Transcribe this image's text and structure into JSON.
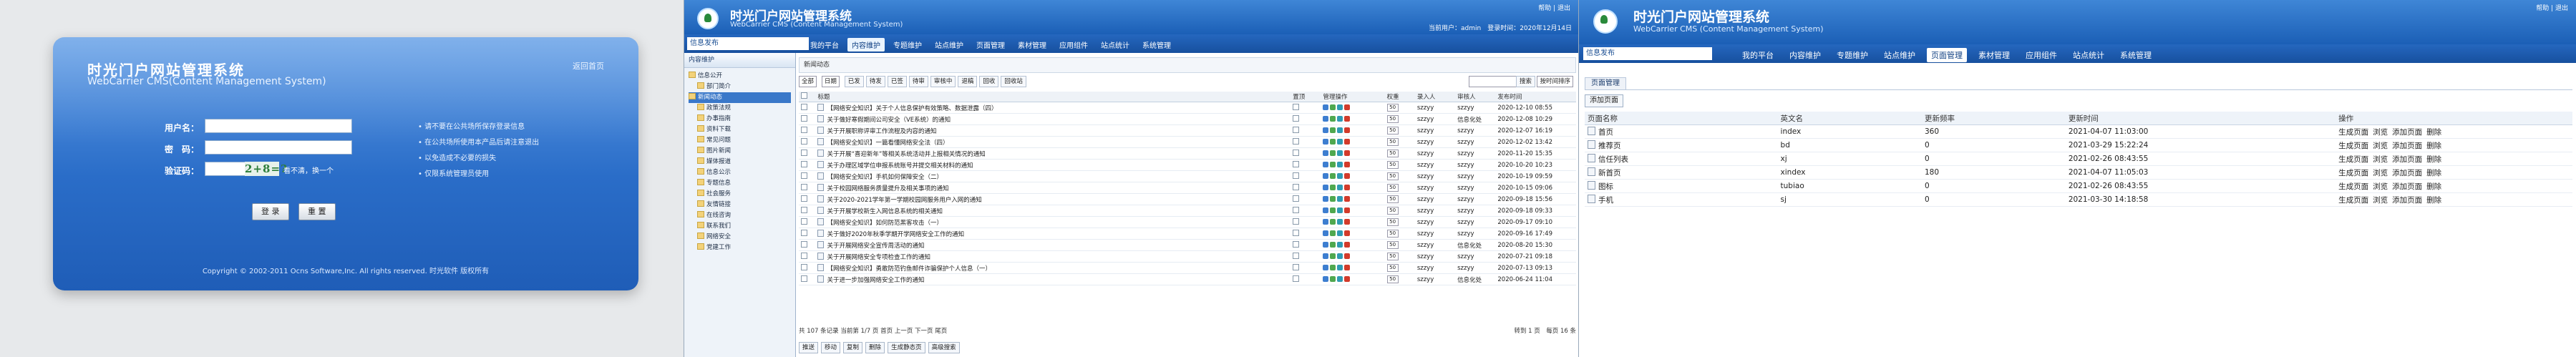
{
  "login": {
    "title": "时光门户网站管理系统",
    "subtitle": "WebCarrier CMS(Content Management System)",
    "home_link": "返回首页",
    "username_label": "用户名：",
    "password_label": "密　码：",
    "captcha_label": "验证码：",
    "captcha_code": "2+8=?",
    "captcha_refresh": "看不清，换一个",
    "tips": [
      "请不要在公共场所保存登录信息",
      "在公共场所使用本产品后请注意退出",
      "以免造成不必要的损失",
      "仅限系统管理员使用"
    ],
    "login_button": "登 录",
    "reset_button": "重 置",
    "copyright": "Copyright © 2002-2011 Ocns Software,Inc. All rights reserved. 时光软件 版权所有"
  },
  "cms": {
    "title": "时光门户网站管理系统",
    "subtitle": "WebCarrier CMS (Content Management System)",
    "top_right": "帮助 | 退出",
    "user_info": "当前用户：admin　登录时间：2020年12月14日　退出系统",
    "current_section": "信息发布",
    "nav": [
      "我的平台",
      "内容维护",
      "专题维护",
      "站点维护",
      "页面管理",
      "素材管理",
      "应用组件",
      "站点统计",
      "系统管理"
    ],
    "sidebar_head": "内容维护",
    "tree": [
      "信息公开",
      "部门简介",
      "新闻动态",
      "政策法规",
      "办事指南",
      "资料下载",
      "常见问题",
      "图片新闻",
      "媒体报道",
      "信息公示",
      "专题信息",
      "社会服务",
      "友情链接",
      "在线咨询",
      "联系我们",
      "网络安全",
      "党建工作"
    ],
    "tree_selected": 2,
    "crumb": "新闻动态",
    "filter_all": "全部",
    "filter_all_day": "日期",
    "toolbar": [
      "已发",
      "待发",
      "已签",
      "待审",
      "审核中",
      "退稿",
      "回收",
      "回收站"
    ],
    "search_btn": "搜索",
    "sort_label": "按时间排序",
    "columns": [
      "",
      "标题",
      "置顶",
      "管理操作",
      "权重",
      "录入人",
      "审核人",
      "发布时间"
    ],
    "rows": [
      {
        "title": "【网络安全知识】关于个人信息保护有效策略、数据泄露（四）",
        "author": "szzyy",
        "reviewer": "szzyy",
        "date": "2020-12-10 08:55"
      },
      {
        "title": "关于做好寒假期间公司安全（VE系统）的通知",
        "author": "szzyy",
        "reviewer": "信息化处",
        "date": "2020-12-08 10:29"
      },
      {
        "title": "关于开展职称评审工作流程及内容的通知",
        "author": "szzyy",
        "reviewer": "szzyy",
        "date": "2020-12-07 16:19"
      },
      {
        "title": "【网络安全知识】一篇看懂网络安全法（四）",
        "author": "szzyy",
        "reviewer": "szzyy",
        "date": "2020-12-02 13:42"
      },
      {
        "title": "关于开展“喜迎新年”等相关系统活动并上报相关情况的通知",
        "author": "szzyy",
        "reviewer": "szzyy",
        "date": "2020-11-20 15:35"
      },
      {
        "title": "关于办理区域学位申报系统账号并提交相关材料的通知",
        "author": "szzyy",
        "reviewer": "szzyy",
        "date": "2020-10-20 10:23"
      },
      {
        "title": "【网络安全知识】手机如何保障安全（二）",
        "author": "szzyy",
        "reviewer": "szzyy",
        "date": "2020-10-19 09:59"
      },
      {
        "title": "关于校园网络服务质量提升及相关事项的通知",
        "author": "szzyy",
        "reviewer": "szzyy",
        "date": "2020-10-15 09:06"
      },
      {
        "title": "关于2020-2021学年第一学期校园网服务用户入网的通知",
        "author": "szzyy",
        "reviewer": "szzyy",
        "date": "2020-09-18 15:56"
      },
      {
        "title": "关于开展学校新生入网信息系统的相关通知",
        "author": "szzyy",
        "reviewer": "szzyy",
        "date": "2020-09-18 09:33"
      },
      {
        "title": "【网络安全知识】如何防范黑客攻击（一）",
        "author": "szzyy",
        "reviewer": "szzyy",
        "date": "2020-09-17 09:10"
      },
      {
        "title": "关于做好2020年秋季学期开学网络安全工作的通知",
        "author": "szzyy",
        "reviewer": "szzyy",
        "date": "2020-09-16 17:49"
      },
      {
        "title": "关于开展网络安全宣传周活动的通知",
        "author": "szzyy",
        "reviewer": "信息化处",
        "date": "2020-08-20 15:30"
      },
      {
        "title": "关于开展网络安全专项检查工作的通知",
        "author": "szzyy",
        "reviewer": "szzyy",
        "date": "2020-07-21 09:18"
      },
      {
        "title": "【网络安全知识】勇敢防范钓鱼邮件诈骗保护个人信息（一）",
        "author": "szzyy",
        "reviewer": "szzyy",
        "date": "2020-07-13 09:13"
      },
      {
        "title": "关于进一步加强网络安全工作的通知",
        "author": "szzyy",
        "reviewer": "信息化处",
        "date": "2020-06-24 11:04"
      }
    ],
    "pager_left": "共 107 条记录 当前第 1/7 页 首页 上一页 下一页 尾页",
    "pager_right": "转到 1 页　每页 16 条",
    "bottom_buttons": [
      "推送",
      "移动",
      "复制",
      "删除",
      "生成静态页",
      "高级搜索"
    ]
  },
  "pages": {
    "title": "时光门户网站管理系统",
    "subtitle": "WebCarrier CMS (Content Management System)",
    "top_right": "帮助 | 退出",
    "current_section": "信息发布",
    "nav": [
      "我的平台",
      "内容维护",
      "专题维护",
      "站点维护",
      "页面管理",
      "素材管理",
      "应用组件",
      "站点统计",
      "系统管理"
    ],
    "active_nav": 4,
    "tab": "页面管理",
    "add_button": "添加页面",
    "columns": [
      "页面名称",
      "英文名",
      "更新频率",
      "更新时间",
      "操作"
    ],
    "rows": [
      {
        "name": "首页",
        "en": "index",
        "freq": "360",
        "time": "2021-04-07 11:03:00"
      },
      {
        "name": "推荐页",
        "en": "bd",
        "freq": "0",
        "time": "2021-03-29 15:22:24"
      },
      {
        "name": "信任列表",
        "en": "xj",
        "freq": "0",
        "time": "2021-02-26 08:43:55"
      },
      {
        "name": "新首页",
        "en": "xindex",
        "freq": "180",
        "time": "2021-04-07 11:05:03"
      },
      {
        "name": "图标",
        "en": "tubiao",
        "freq": "0",
        "time": "2021-02-26 08:43:55"
      },
      {
        "name": "手机",
        "en": "sj",
        "freq": "0",
        "time": "2021-03-30 14:18:58"
      }
    ],
    "actions": [
      "生成页面",
      "浏览",
      "添加页面",
      "删除"
    ]
  }
}
